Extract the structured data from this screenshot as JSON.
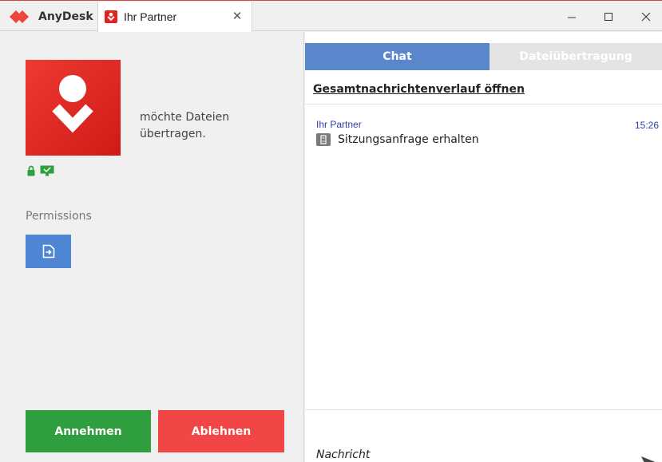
{
  "titlebar": {
    "app_title": "AnyDesk",
    "tab_label": "Ihr Partner",
    "tab_close_glyph": "✕",
    "brand_color": "#e2221e"
  },
  "left": {
    "request_text": "möchte Dateien übertragen.",
    "permissions_heading": "Permissions",
    "accept_label": "Annehmen",
    "reject_label": "Ablehnen",
    "accept_color": "#2f9e3f",
    "reject_color": "#f24545"
  },
  "right": {
    "tabs": [
      {
        "label": "Chat",
        "active": true
      },
      {
        "label": "Dateiübertragung",
        "active": false
      }
    ],
    "history_link": "Gesamtnachrichtenverlauf öffnen",
    "messages": [
      {
        "sender": "Ihr Partner",
        "time": "15:26",
        "text": "Sitzungsanfrage erhalten",
        "icon": "session-request-icon"
      }
    ],
    "input_placeholder": "Nachricht"
  }
}
